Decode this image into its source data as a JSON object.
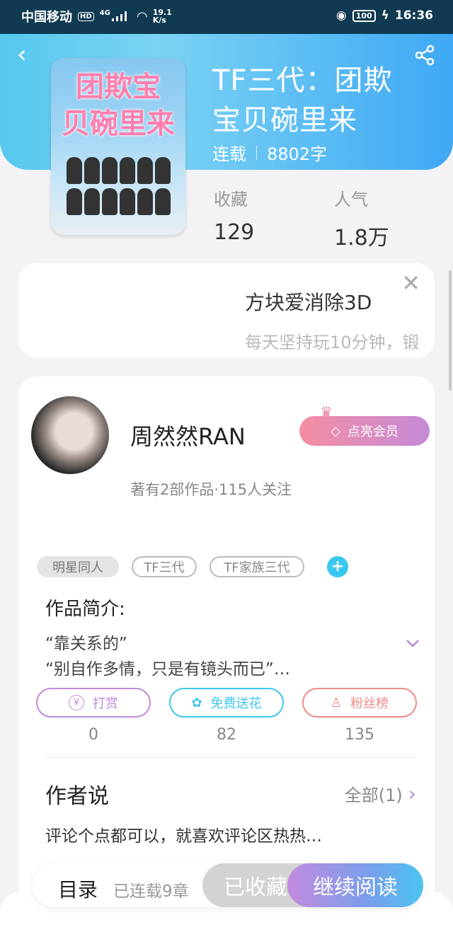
{
  "status": {
    "carrier": "中国移动",
    "hd": "HD",
    "network": "4G",
    "speed_top": "19.1",
    "speed_bottom": "K/s",
    "battery": "100",
    "time": "16:36"
  },
  "book": {
    "title_line1": "TF三代：团欺",
    "title_line2": "宝贝碗里来",
    "status": "连载",
    "words": "8802字",
    "cover_line1": "团欺宝",
    "cover_line2": "贝碗里来",
    "fav_label": "收藏",
    "fav_value": "129",
    "pop_label": "人气",
    "pop_value": "1.8万"
  },
  "ad": {
    "title": "方块爱消除3D",
    "subtitle": "每天坚持玩10分钟，锻"
  },
  "author": {
    "name": "周然然RAN",
    "vip": "点亮会员",
    "works": "著有2部作品·115人关注"
  },
  "tags": [
    "明星同人",
    "TF三代",
    "TF家族三代"
  ],
  "intro": {
    "heading": "作品简介:",
    "line1": "“靠关系的”",
    "line2": "“别自作多情，只是有镜头而已”…"
  },
  "actions": [
    {
      "label": "打赏",
      "count": "0",
      "color": "#c08ad8"
    },
    {
      "label": "免费送花",
      "count": "82",
      "color": "#3cc6ee"
    },
    {
      "label": "粉丝榜",
      "count": "135",
      "color": "#f08a8a"
    }
  ],
  "author_says": {
    "heading": "作者说",
    "all": "全部(1)",
    "text": "评论个点都可以，就喜欢评论区热热…"
  },
  "bottom": {
    "toc": "目录",
    "toc_sub": "已连载9章",
    "collected": "已收藏",
    "read": "继续阅读"
  }
}
